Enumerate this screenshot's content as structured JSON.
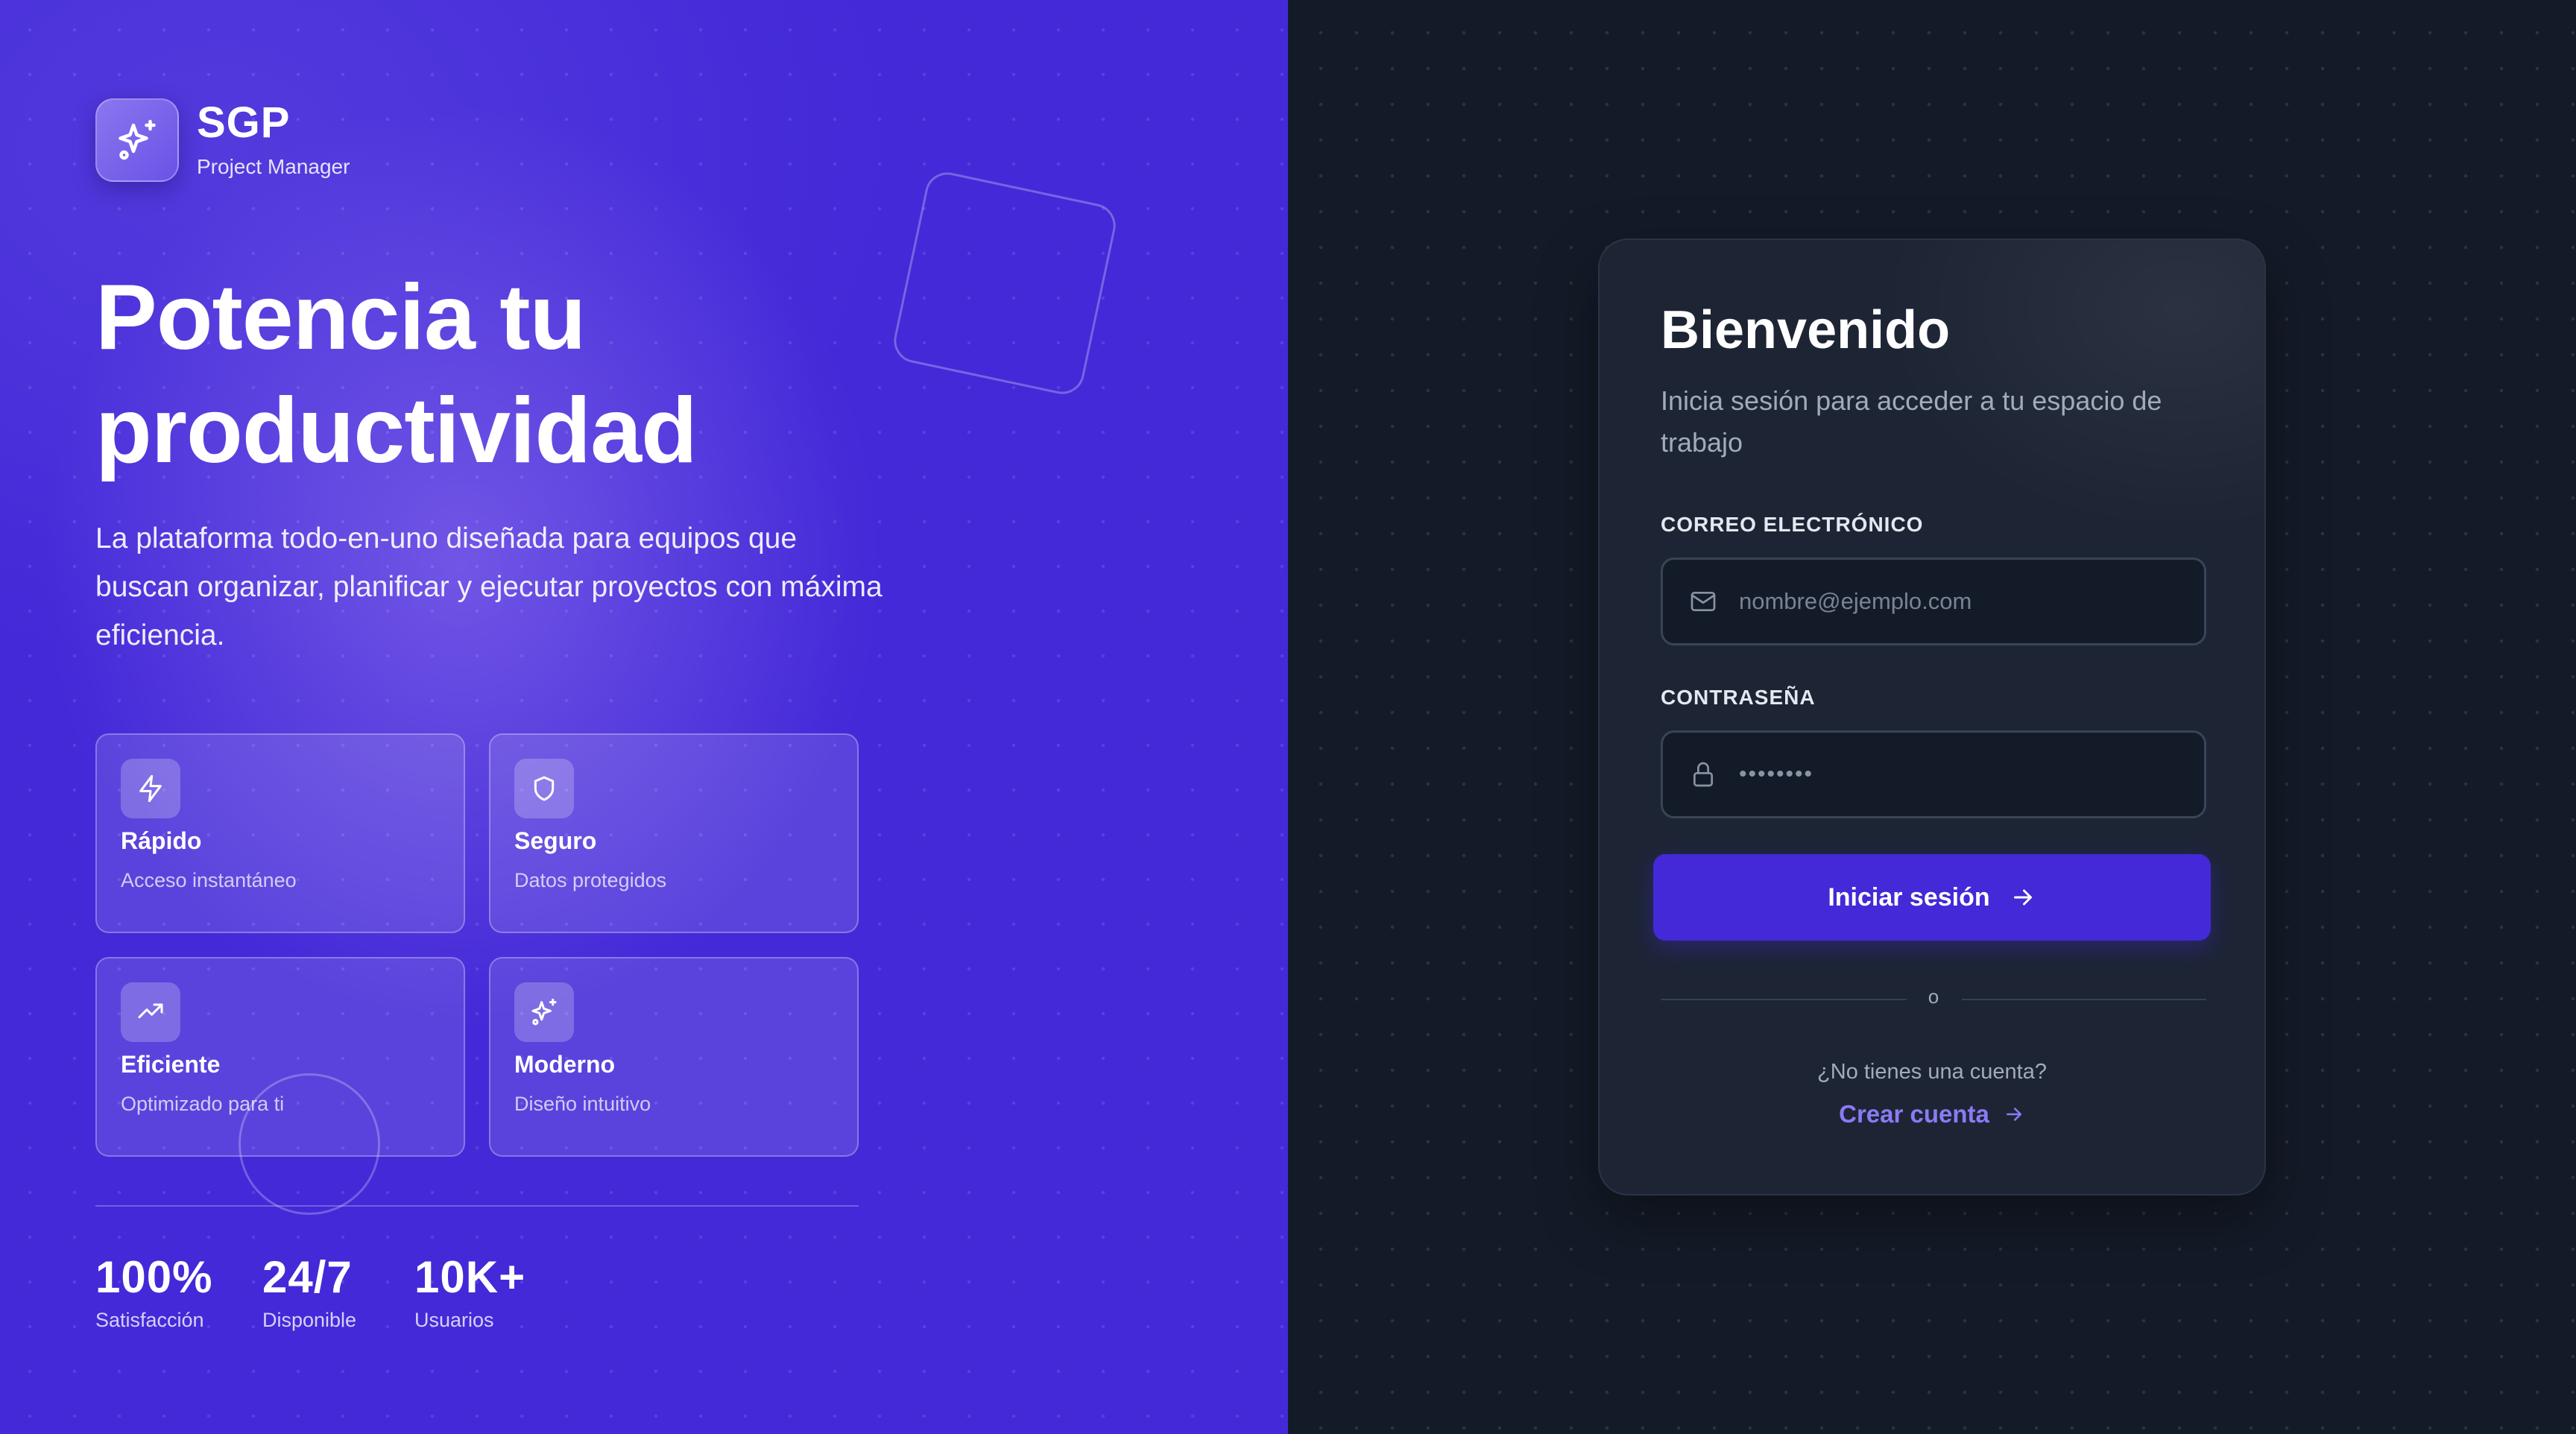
{
  "brand": {
    "name": "SGP",
    "subtitle": "Project Manager",
    "logo_icon": "sparkles-icon"
  },
  "hero": {
    "title_line1": "Potencia tu",
    "title_line2": "productividad",
    "description": "La plataforma todo-en-uno diseñada para equipos que buscan organizar, planificar y ejecutar proyectos con máxima eficiencia."
  },
  "features": [
    {
      "title": "Rápido",
      "subtitle": "Acceso instantáneo",
      "icon": "lightning-icon"
    },
    {
      "title": "Seguro",
      "subtitle": "Datos protegidos",
      "icon": "shield-icon"
    },
    {
      "title": "Eficiente",
      "subtitle": "Optimizado para ti",
      "icon": "trending-up-icon"
    },
    {
      "title": "Moderno",
      "subtitle": "Diseño intuitivo",
      "icon": "sparkles-icon"
    }
  ],
  "stats": [
    {
      "value": "100%",
      "label": "Satisfacción"
    },
    {
      "value": "24/7",
      "label": "Disponible"
    },
    {
      "value": "10K+",
      "label": "Usuarios"
    }
  ],
  "login": {
    "title": "Bienvenido",
    "subtitle": "Inicia sesión para acceder a tu espacio de trabajo",
    "email_label": "CORREO ELECTRÓNICO",
    "email_placeholder": "nombre@ejemplo.com",
    "password_label": "CONTRASEÑA",
    "password_value": "••••••••",
    "submit_label": "Iniciar sesión",
    "divider_text": "o",
    "no_account_text": "¿No tienes una cuenta?",
    "create_account_label": "Crear cuenta"
  },
  "colors": {
    "primary": "#4329d8",
    "accent_link": "#8b7af5",
    "dark_bg": "#141b28",
    "card_bg": "#1d2535"
  }
}
